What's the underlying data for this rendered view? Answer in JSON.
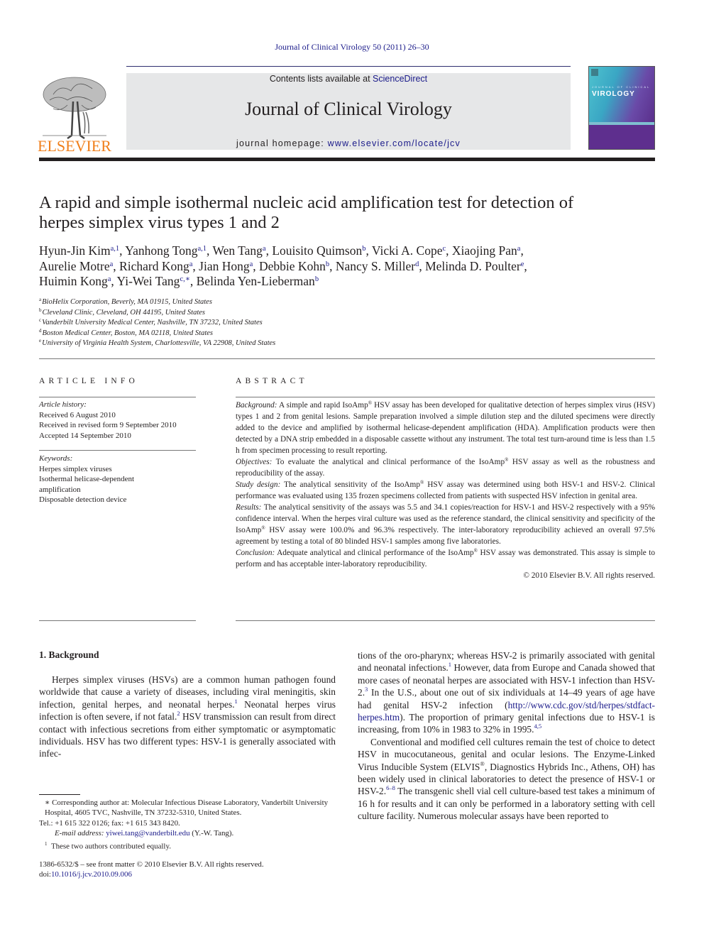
{
  "header": {
    "running_head": "Journal of Clinical Virology 50 (2011) 26–30",
    "contents_prefix": "Contents lists available at ",
    "contents_link": "ScienceDirect",
    "journal_title": "Journal of Clinical Virology",
    "homepage_prefix": "journal homepage: ",
    "homepage_link": "www.elsevier.com/locate/jcv",
    "publisher_logo_text": "ELSEVIER",
    "cover_title_pre": "JOURNAL OF CLINICAL",
    "cover_title": "VIROLOGY",
    "colors": {
      "link": "#1b1b8a",
      "elsevier_orange": "#f07f1b",
      "banner_gray": "#e6e7e8"
    }
  },
  "article": {
    "title_line1": "A rapid and simple isothermal nucleic acid amplification test for detection of",
    "title_line2": "herpes simplex virus types 1 and 2",
    "authors": [
      {
        "name": "Hyun-Jin Kim",
        "sup": "a,1"
      },
      {
        "name": "Yanhong Tong",
        "sup": "a,1"
      },
      {
        "name": "Wen Tang",
        "sup": "a"
      },
      {
        "name": "Louisito Quimson",
        "sup": "b"
      },
      {
        "name": "Vicki A. Cope",
        "sup": "c"
      },
      {
        "name": "Xiaojing Pan",
        "sup": "a"
      },
      {
        "name": "Aurelie Motre",
        "sup": "a"
      },
      {
        "name": "Richard Kong",
        "sup": "a"
      },
      {
        "name": "Jian Hong",
        "sup": "a"
      },
      {
        "name": "Debbie Kohn",
        "sup": "b"
      },
      {
        "name": "Nancy S. Miller",
        "sup": "d"
      },
      {
        "name": "Melinda D. Poulter",
        "sup": "e"
      },
      {
        "name": "Huimin Kong",
        "sup": "a"
      },
      {
        "name": "Yi-Wei Tang",
        "sup": "c,∗"
      },
      {
        "name": "Belinda Yen-Lieberman",
        "sup": "b"
      }
    ],
    "affiliations": [
      {
        "key": "a",
        "text": "BioHelix Corporation, Beverly, MA 01915, United States"
      },
      {
        "key": "b",
        "text": "Cleveland Clinic, Cleveland, OH 44195, United States"
      },
      {
        "key": "c",
        "text": "Vanderbilt University Medical Center, Nashville, TN 37232, United States"
      },
      {
        "key": "d",
        "text": "Boston Medical Center, Boston, MA 02118, United States"
      },
      {
        "key": "e",
        "text": "University of Virginia Health System, Charlottesville, VA 22908, United States"
      }
    ]
  },
  "article_info": {
    "heading": "ARTICLE INFO",
    "history_label": "Article history:",
    "history": [
      "Received 6 August 2010",
      "Received in revised form 9 September 2010",
      "Accepted 14 September 2010"
    ],
    "keywords_label": "Keywords:",
    "keywords": [
      "Herpes simplex viruses",
      "Isothermal helicase-dependent",
      "amplification",
      "Disposable detection device"
    ]
  },
  "abstract": {
    "heading": "ABSTRACT",
    "background_label": "Background:",
    "background_a": " A simple and rapid IsoAmp",
    "background_b": " HSV assay has been developed for qualitative detection of herpes simplex virus (HSV) types 1 and 2 from genital lesions. Sample preparation involved a simple dilution step and the diluted specimens were directly added to the device and amplified by isothermal helicase-dependent amplification (HDA). Amplification products were then detected by a DNA strip embedded in a disposable cassette without any instrument. The total test turn-around time is less than 1.5 h from specimen processing to result reporting.",
    "objectives_label": "Objectives:",
    "objectives_a": " To evaluate the analytical and clinical performance of the IsoAmp",
    "objectives_b": " HSV assay as well as the robustness and reproducibility of the assay.",
    "design_label": "Study design:",
    "design_a": " The analytical sensitivity of the IsoAmp",
    "design_b": " HSV assay was determined using both HSV-1 and HSV-2. Clinical performance was evaluated using 135 frozen specimens collected from patients with suspected HSV infection in genital area.",
    "results_label": "Results:",
    "results_a": " The analytical sensitivity of the assays was 5.5 and 34.1 copies/reaction for HSV-1 and HSV-2 respectively with a 95% confidence interval. When the herpes viral culture was used as the reference standard, the clinical sensitivity and specificity of the IsoAmp",
    "results_b": " HSV assay were 100.0% and 96.3% respectively. The inter-laboratory reproducibility achieved an overall 97.5% agreement by testing a total of 80 blinded HSV-1 samples among five laboratories.",
    "conclusion_label": "Conclusion:",
    "conclusion_a": " Adequate analytical and clinical performance of the IsoAmp",
    "conclusion_b": " HSV assay was demonstrated. This assay is simple to perform and has acceptable inter-laboratory reproducibility.",
    "registered": "®",
    "copyright": "© 2010 Elsevier B.V. All rights reserved."
  },
  "body": {
    "section_title": "1.  Background",
    "left_p1": [
      "Herpes simplex viruses (HSVs) are a common human pathogen found worldwide that cause a variety of diseases, including viral meningitis, skin infection, genital herpes, and neonatal herpes.",
      "1",
      " Neonatal herpes virus infection is often severe, if not fatal.",
      "2",
      " HSV transmission can result from direct contact with infectious secretions from either symptomatic or asymptomatic individuals. HSV has two different types: HSV-1 is generally associated with infec-"
    ],
    "right_p1": [
      "tions of the oro-pharynx; whereas HSV-2 is primarily associated with genital and neonatal infections.",
      "1",
      " However, data from Europe and Canada showed that more cases of neonatal herpes are associated with HSV-1 infection than HSV-2.",
      "3",
      " In the U.S., about one out of six individuals at 14–49 years of age have had genital HSV-2 infection (",
      "http://www.cdc.gov/std/herpes/stdfact-herpes.htm",
      "). The proportion of primary genital infections due to HSV-1 is increasing, from 10% in 1983 to 32% in 1995.",
      "4,5"
    ],
    "right_p2": [
      "Conventional and modified cell cultures remain the test of choice to detect HSV in mucocutaneous, genital and ocular lesions. The Enzyme-Linked Virus Inducible System (ELVIS",
      "®",
      ", Diagnostics Hybrids Inc., Athens, OH) has been widely used in clinical laboratories to detect the presence of HSV-1 or HSV-2.",
      "6–8",
      " The transgenic shell vial cell culture-based test takes a minimum of 16 h for results and it can only be performed in a laboratory setting with cell culture facility. Numerous molecular assays have been reported to"
    ]
  },
  "footnotes": {
    "corresponding": "∗ Corresponding author at: Molecular Infectious Disease Laboratory, Vanderbilt University Hospital, 4605 TVC, Nashville, TN 37232-5310, United States.",
    "tel": "Tel.: +1 615 322 0126; fax: +1 615 343 8420.",
    "email_label": "E-mail address:",
    "email": "yiwei.tang@vanderbilt.edu",
    "email_suffix": " (Y.-W. Tang).",
    "equal_sup": "1",
    "equal": "These two authors contributed equally.",
    "issn": "1386-6532/$ – see front matter © 2010 Elsevier B.V. All rights reserved.",
    "doi_prefix": "doi:",
    "doi": "10.1016/j.jcv.2010.09.006"
  }
}
